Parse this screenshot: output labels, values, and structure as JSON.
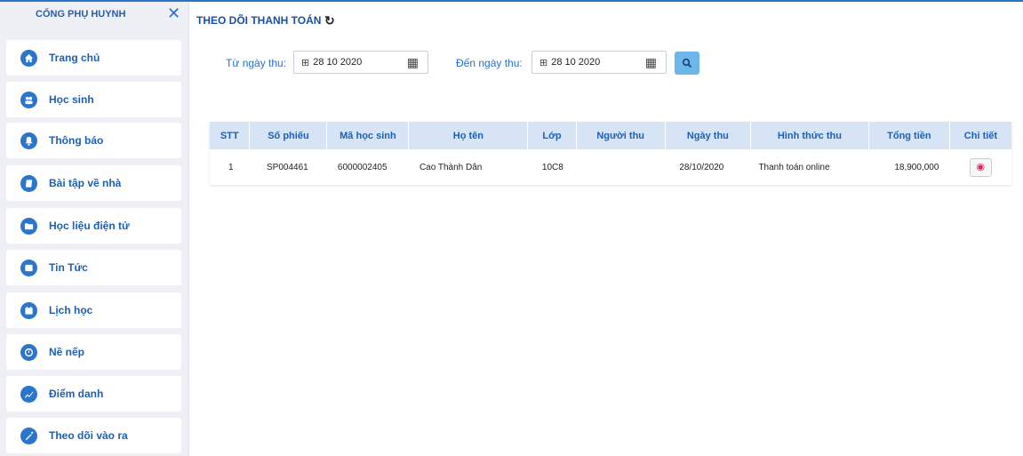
{
  "sidebar": {
    "title": "CỔNG PHỤ HUYNH",
    "close_icon": "close-icon",
    "items": [
      {
        "label": "Trang chủ",
        "icon": "home-icon"
      },
      {
        "label": "Học sinh",
        "icon": "student-icon"
      },
      {
        "label": "Thông báo",
        "icon": "bell-icon"
      },
      {
        "label": "Bài tập về nhà",
        "icon": "homework-icon"
      },
      {
        "label": "Học liệu điện tử",
        "icon": "folder-icon"
      },
      {
        "label": "Tin Tức",
        "icon": "news-icon"
      },
      {
        "label": "Lịch học",
        "icon": "calendar-icon"
      },
      {
        "label": "Nề nếp",
        "icon": "clock-icon"
      },
      {
        "label": "Điểm danh",
        "icon": "chart-icon"
      },
      {
        "label": "Theo dõi vào ra",
        "icon": "wand-icon"
      }
    ]
  },
  "header": {
    "title": "THEO DÕI THANH TOÁN",
    "refresh_icon": "refresh-icon"
  },
  "filters": {
    "from_label": "Từ ngày thu:",
    "from_value": "28 10 2020",
    "to_label": "Đến ngày thu:",
    "to_value": "28 10 2020",
    "search_icon": "search-icon"
  },
  "table": {
    "columns": [
      "STT",
      "Số phiếu",
      "Mã học sinh",
      "Họ tên",
      "Lớp",
      "Người thu",
      "Ngày thu",
      "Hình thức thu",
      "Tổng tiền",
      "Chi tiết"
    ],
    "rows": [
      {
        "stt": "1",
        "so_phieu": "SP004461",
        "ma_hoc_sinh": "6000002405",
        "ho_ten": "Cao Thành Dân",
        "lop": "10C8",
        "nguoi_thu": "",
        "ngay_thu": "28/10/2020",
        "hinh_thuc_thu": "Thanh toán online",
        "tong_tien": "18,900,000"
      }
    ]
  },
  "colors": {
    "accent": "#2c75cc",
    "header_text": "#1b4f9c",
    "table_header_bg": "#d6e4f5",
    "search_button": "#6cb6ea",
    "sidebar_bg": "#eef0f6"
  }
}
